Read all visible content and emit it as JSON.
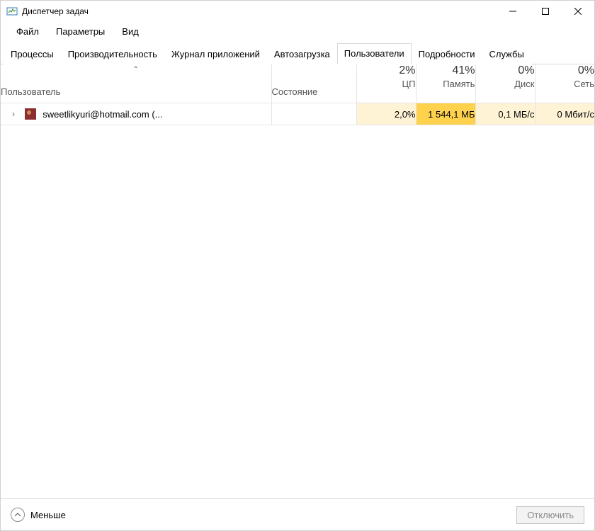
{
  "window": {
    "title": "Диспетчер задач"
  },
  "menu": {
    "file": "Файл",
    "options": "Параметры",
    "view": "Вид"
  },
  "tabs": {
    "processes": "Процессы",
    "performance": "Производительность",
    "apphistory": "Журнал приложений",
    "startup": "Автозагрузка",
    "users": "Пользователи",
    "details": "Подробности",
    "services": "Службы",
    "active": "users"
  },
  "columns": {
    "user": "Пользователь",
    "status": "Состояние",
    "cpu": {
      "pct": "2%",
      "label": "ЦП"
    },
    "memory": {
      "pct": "41%",
      "label": "Память"
    },
    "disk": {
      "pct": "0%",
      "label": "Диск"
    },
    "network": {
      "pct": "0%",
      "label": "Сеть"
    }
  },
  "rows": [
    {
      "name": "sweetlikyuri@hotmail.com (...",
      "status": "",
      "cpu": "2,0%",
      "memory": "1 544,1 МБ",
      "disk": "0,1 МБ/с",
      "network": "0 Мбит/с"
    }
  ],
  "footer": {
    "less": "Меньше",
    "disconnect": "Отключить"
  }
}
